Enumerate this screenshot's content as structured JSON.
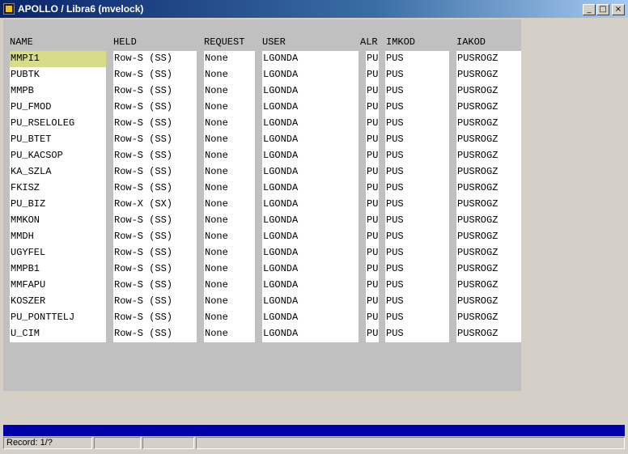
{
  "window": {
    "title": "APOLLO / Libra6 (mvelock)",
    "minimize": "_",
    "maximize": "□",
    "close": "×"
  },
  "columns": [
    {
      "key": "name",
      "label": "NAME"
    },
    {
      "key": "held",
      "label": "HELD"
    },
    {
      "key": "request",
      "label": "REQUEST"
    },
    {
      "key": "user",
      "label": "USER"
    },
    {
      "key": "alr",
      "label": "ALR"
    },
    {
      "key": "imkod",
      "label": "IMKOD"
    },
    {
      "key": "iakod",
      "label": "IAKOD"
    }
  ],
  "selected_row": 0,
  "rows": [
    {
      "name": "MMPI1",
      "held": "Row-S (SS)",
      "request": "None",
      "user": "LGONDA",
      "alr": "PU",
      "imkod": "PUS",
      "iakod": "PUSROGZ"
    },
    {
      "name": "PUBTK",
      "held": "Row-S (SS)",
      "request": "None",
      "user": "LGONDA",
      "alr": "PU",
      "imkod": "PUS",
      "iakod": "PUSROGZ"
    },
    {
      "name": "MMPB",
      "held": "Row-S (SS)",
      "request": "None",
      "user": "LGONDA",
      "alr": "PU",
      "imkod": "PUS",
      "iakod": "PUSROGZ"
    },
    {
      "name": "PU_FMOD",
      "held": "Row-S (SS)",
      "request": "None",
      "user": "LGONDA",
      "alr": "PU",
      "imkod": "PUS",
      "iakod": "PUSROGZ"
    },
    {
      "name": "PU_RSELOLEG",
      "held": "Row-S (SS)",
      "request": "None",
      "user": "LGONDA",
      "alr": "PU",
      "imkod": "PUS",
      "iakod": "PUSROGZ"
    },
    {
      "name": "PU_BTET",
      "held": "Row-S (SS)",
      "request": "None",
      "user": "LGONDA",
      "alr": "PU",
      "imkod": "PUS",
      "iakod": "PUSROGZ"
    },
    {
      "name": "PU_KACSOP",
      "held": "Row-S (SS)",
      "request": "None",
      "user": "LGONDA",
      "alr": "PU",
      "imkod": "PUS",
      "iakod": "PUSROGZ"
    },
    {
      "name": "KA_SZLA",
      "held": "Row-S (SS)",
      "request": "None",
      "user": "LGONDA",
      "alr": "PU",
      "imkod": "PUS",
      "iakod": "PUSROGZ"
    },
    {
      "name": "FKISZ",
      "held": "Row-S (SS)",
      "request": "None",
      "user": "LGONDA",
      "alr": "PU",
      "imkod": "PUS",
      "iakod": "PUSROGZ"
    },
    {
      "name": "PU_BIZ",
      "held": "Row-X (SX)",
      "request": "None",
      "user": "LGONDA",
      "alr": "PU",
      "imkod": "PUS",
      "iakod": "PUSROGZ"
    },
    {
      "name": "MMKON",
      "held": "Row-S (SS)",
      "request": "None",
      "user": "LGONDA",
      "alr": "PU",
      "imkod": "PUS",
      "iakod": "PUSROGZ"
    },
    {
      "name": "MMDH",
      "held": "Row-S (SS)",
      "request": "None",
      "user": "LGONDA",
      "alr": "PU",
      "imkod": "PUS",
      "iakod": "PUSROGZ"
    },
    {
      "name": "UGYFEL",
      "held": "Row-S (SS)",
      "request": "None",
      "user": "LGONDA",
      "alr": "PU",
      "imkod": "PUS",
      "iakod": "PUSROGZ"
    },
    {
      "name": "MMPB1",
      "held": "Row-S (SS)",
      "request": "None",
      "user": "LGONDA",
      "alr": "PU",
      "imkod": "PUS",
      "iakod": "PUSROGZ"
    },
    {
      "name": "MMFAPU",
      "held": "Row-S (SS)",
      "request": "None",
      "user": "LGONDA",
      "alr": "PU",
      "imkod": "PUS",
      "iakod": "PUSROGZ"
    },
    {
      "name": "KOSZER",
      "held": "Row-S (SS)",
      "request": "None",
      "user": "LGONDA",
      "alr": "PU",
      "imkod": "PUS",
      "iakod": "PUSROGZ"
    },
    {
      "name": "PU_PONTTELJ",
      "held": "Row-S (SS)",
      "request": "None",
      "user": "LGONDA",
      "alr": "PU",
      "imkod": "PUS",
      "iakod": "PUSROGZ"
    },
    {
      "name": "U_CIM",
      "held": "Row-S (SS)",
      "request": "None",
      "user": "LGONDA",
      "alr": "PU",
      "imkod": "PUS",
      "iakod": "PUSROGZ"
    }
  ],
  "status": {
    "record": "Record: 1/?",
    "panel2": "",
    "panel3": "",
    "panel4": ""
  },
  "colors": {
    "title_start": "#0a246a",
    "selected_cell": "#d6dc8a",
    "progress": "#0000a8"
  }
}
